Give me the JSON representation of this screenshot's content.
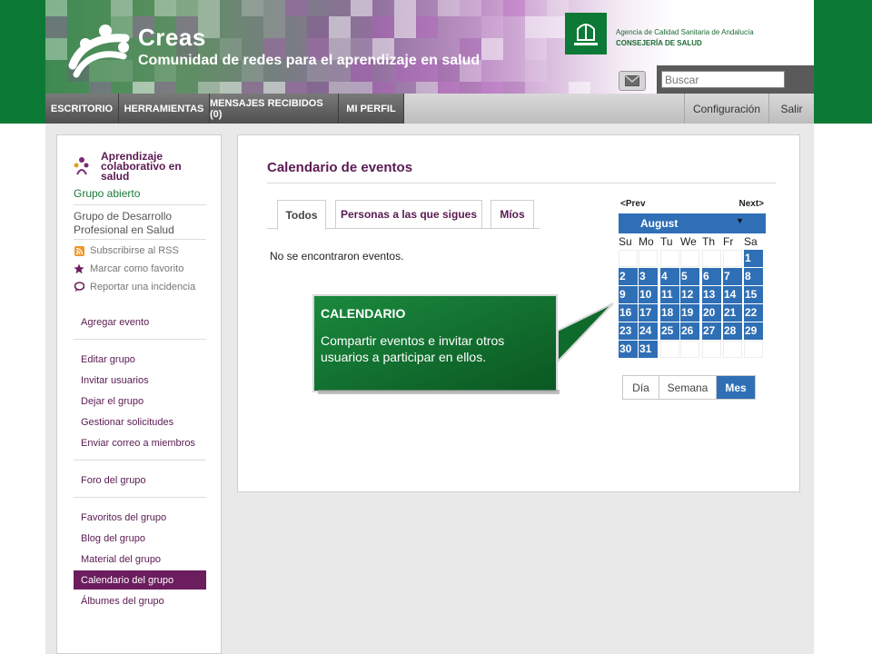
{
  "header": {
    "brand_title": "Creas",
    "brand_subtitle": "Comunidad de redes para el aprendizaje en salud",
    "agency_line1": "Agencia de Calidad Sanitaria de Andalucía",
    "agency_line2": "CONSEJERÍA DE SALUD",
    "mail_icon": "envelope-icon",
    "search_placeholder": "Buscar",
    "search_icon": "magnifier-icon"
  },
  "nav": {
    "items": [
      "ESCRITORIO",
      "HERRAMIENTAS",
      "MENSAJES RECIBIDOS (0)",
      "MI PERFIL"
    ],
    "right": [
      "Configuración",
      "Salir"
    ]
  },
  "sidebar": {
    "group_name": "Aprendizaje colaborativo en salud",
    "group_status": "Grupo abierto",
    "group_category": "Grupo de Desarrollo Profesional en Salud",
    "actions": [
      {
        "label": "Subscribirse al RSS",
        "icon": "rss-icon"
      },
      {
        "label": "Marcar como favorito",
        "icon": "star-icon"
      },
      {
        "label": "Reportar una incidencia",
        "icon": "speech-bubble-icon"
      }
    ],
    "links": [
      "Agregar evento",
      "Editar grupo",
      "Invitar usuarios",
      "Dejar el grupo",
      "Gestionar solicitudes",
      "Enviar correo a miembros",
      "Foro del grupo",
      "Favoritos del grupo",
      "Blog del grupo",
      "Material del grupo",
      "Calendario del grupo",
      "Álbumes del grupo"
    ],
    "active_link": "Calendario del grupo"
  },
  "main": {
    "title": "Calendario de eventos",
    "tabs": [
      "Todos",
      "Personas a las que sigues",
      "Míos"
    ],
    "active_tab": "Todos",
    "empty_message": "No se encontraron eventos."
  },
  "calendar": {
    "prev_label": "<Prev",
    "next_label": "Next>",
    "month": "August",
    "weekdays": [
      "Su",
      "Mo",
      "Tu",
      "We",
      "Th",
      "Fr",
      "Sa"
    ],
    "first_weekday_index": 6,
    "days_in_month": 31,
    "views": [
      "Día",
      "Semana",
      "Mes"
    ],
    "active_view": "Mes"
  },
  "callout": {
    "title": "CALENDARIO",
    "body": "Compartir eventos e invitar otros usuarios a participar en ellos."
  },
  "colors": {
    "green": "#0c7a36",
    "purple": "#5a1a52",
    "calendar_blue": "#2f6fb5",
    "callout_green": "#0f6b2c"
  }
}
